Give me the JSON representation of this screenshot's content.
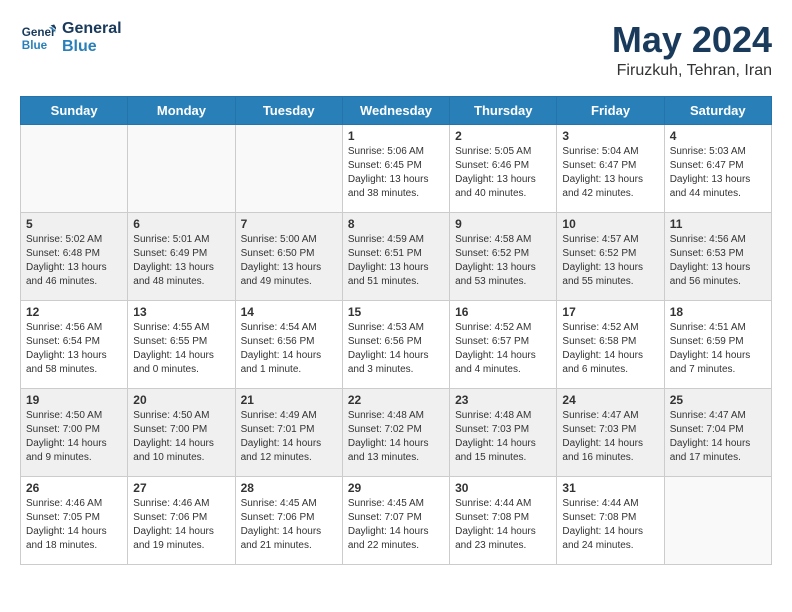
{
  "header": {
    "logo_line1": "General",
    "logo_line2": "Blue",
    "month": "May 2024",
    "location": "Firuzkuh, Tehran, Iran"
  },
  "weekdays": [
    "Sunday",
    "Monday",
    "Tuesday",
    "Wednesday",
    "Thursday",
    "Friday",
    "Saturday"
  ],
  "weeks": [
    [
      {
        "day": "",
        "info": ""
      },
      {
        "day": "",
        "info": ""
      },
      {
        "day": "",
        "info": ""
      },
      {
        "day": "1",
        "info": "Sunrise: 5:06 AM\nSunset: 6:45 PM\nDaylight: 13 hours\nand 38 minutes."
      },
      {
        "day": "2",
        "info": "Sunrise: 5:05 AM\nSunset: 6:46 PM\nDaylight: 13 hours\nand 40 minutes."
      },
      {
        "day": "3",
        "info": "Sunrise: 5:04 AM\nSunset: 6:47 PM\nDaylight: 13 hours\nand 42 minutes."
      },
      {
        "day": "4",
        "info": "Sunrise: 5:03 AM\nSunset: 6:47 PM\nDaylight: 13 hours\nand 44 minutes."
      }
    ],
    [
      {
        "day": "5",
        "info": "Sunrise: 5:02 AM\nSunset: 6:48 PM\nDaylight: 13 hours\nand 46 minutes."
      },
      {
        "day": "6",
        "info": "Sunrise: 5:01 AM\nSunset: 6:49 PM\nDaylight: 13 hours\nand 48 minutes."
      },
      {
        "day": "7",
        "info": "Sunrise: 5:00 AM\nSunset: 6:50 PM\nDaylight: 13 hours\nand 49 minutes."
      },
      {
        "day": "8",
        "info": "Sunrise: 4:59 AM\nSunset: 6:51 PM\nDaylight: 13 hours\nand 51 minutes."
      },
      {
        "day": "9",
        "info": "Sunrise: 4:58 AM\nSunset: 6:52 PM\nDaylight: 13 hours\nand 53 minutes."
      },
      {
        "day": "10",
        "info": "Sunrise: 4:57 AM\nSunset: 6:52 PM\nDaylight: 13 hours\nand 55 minutes."
      },
      {
        "day": "11",
        "info": "Sunrise: 4:56 AM\nSunset: 6:53 PM\nDaylight: 13 hours\nand 56 minutes."
      }
    ],
    [
      {
        "day": "12",
        "info": "Sunrise: 4:56 AM\nSunset: 6:54 PM\nDaylight: 13 hours\nand 58 minutes."
      },
      {
        "day": "13",
        "info": "Sunrise: 4:55 AM\nSunset: 6:55 PM\nDaylight: 14 hours\nand 0 minutes."
      },
      {
        "day": "14",
        "info": "Sunrise: 4:54 AM\nSunset: 6:56 PM\nDaylight: 14 hours\nand 1 minute."
      },
      {
        "day": "15",
        "info": "Sunrise: 4:53 AM\nSunset: 6:56 PM\nDaylight: 14 hours\nand 3 minutes."
      },
      {
        "day": "16",
        "info": "Sunrise: 4:52 AM\nSunset: 6:57 PM\nDaylight: 14 hours\nand 4 minutes."
      },
      {
        "day": "17",
        "info": "Sunrise: 4:52 AM\nSunset: 6:58 PM\nDaylight: 14 hours\nand 6 minutes."
      },
      {
        "day": "18",
        "info": "Sunrise: 4:51 AM\nSunset: 6:59 PM\nDaylight: 14 hours\nand 7 minutes."
      }
    ],
    [
      {
        "day": "19",
        "info": "Sunrise: 4:50 AM\nSunset: 7:00 PM\nDaylight: 14 hours\nand 9 minutes."
      },
      {
        "day": "20",
        "info": "Sunrise: 4:50 AM\nSunset: 7:00 PM\nDaylight: 14 hours\nand 10 minutes."
      },
      {
        "day": "21",
        "info": "Sunrise: 4:49 AM\nSunset: 7:01 PM\nDaylight: 14 hours\nand 12 minutes."
      },
      {
        "day": "22",
        "info": "Sunrise: 4:48 AM\nSunset: 7:02 PM\nDaylight: 14 hours\nand 13 minutes."
      },
      {
        "day": "23",
        "info": "Sunrise: 4:48 AM\nSunset: 7:03 PM\nDaylight: 14 hours\nand 15 minutes."
      },
      {
        "day": "24",
        "info": "Sunrise: 4:47 AM\nSunset: 7:03 PM\nDaylight: 14 hours\nand 16 minutes."
      },
      {
        "day": "25",
        "info": "Sunrise: 4:47 AM\nSunset: 7:04 PM\nDaylight: 14 hours\nand 17 minutes."
      }
    ],
    [
      {
        "day": "26",
        "info": "Sunrise: 4:46 AM\nSunset: 7:05 PM\nDaylight: 14 hours\nand 18 minutes."
      },
      {
        "day": "27",
        "info": "Sunrise: 4:46 AM\nSunset: 7:06 PM\nDaylight: 14 hours\nand 19 minutes."
      },
      {
        "day": "28",
        "info": "Sunrise: 4:45 AM\nSunset: 7:06 PM\nDaylight: 14 hours\nand 21 minutes."
      },
      {
        "day": "29",
        "info": "Sunrise: 4:45 AM\nSunset: 7:07 PM\nDaylight: 14 hours\nand 22 minutes."
      },
      {
        "day": "30",
        "info": "Sunrise: 4:44 AM\nSunset: 7:08 PM\nDaylight: 14 hours\nand 23 minutes."
      },
      {
        "day": "31",
        "info": "Sunrise: 4:44 AM\nSunset: 7:08 PM\nDaylight: 14 hours\nand 24 minutes."
      },
      {
        "day": "",
        "info": ""
      }
    ]
  ]
}
